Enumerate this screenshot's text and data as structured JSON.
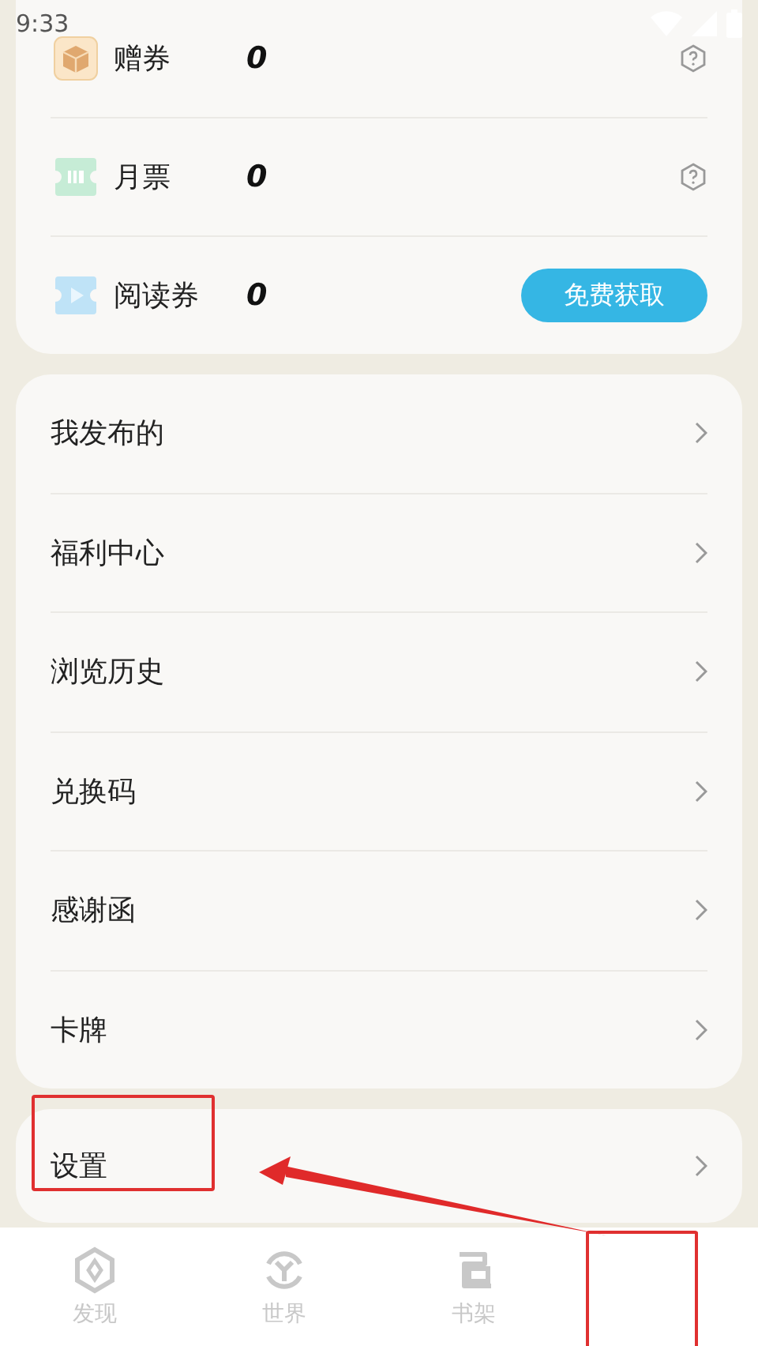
{
  "status_bar": {
    "time": "9:33"
  },
  "vouchers": [
    {
      "kind": "gift",
      "label": "赠券",
      "count": "0",
      "help": true
    },
    {
      "kind": "ticket",
      "label": "月票",
      "count": "0",
      "help": true
    },
    {
      "kind": "play",
      "label": "阅读券",
      "count": "0",
      "help": false,
      "button": "免费获取"
    }
  ],
  "menu": [
    {
      "label": "我发布的"
    },
    {
      "label": "福利中心"
    },
    {
      "label": "浏览历史"
    },
    {
      "label": "兑换码"
    },
    {
      "label": "感谢函"
    },
    {
      "label": "卡牌"
    }
  ],
  "settings": {
    "label": "设置"
  },
  "tabs": [
    {
      "kind": "discover",
      "label": "发现",
      "selected": false
    },
    {
      "kind": "world",
      "label": "世界",
      "selected": false
    },
    {
      "kind": "shelf",
      "label": "书架",
      "selected": false
    },
    {
      "kind": "blank"
    }
  ],
  "annotations": [
    {
      "kind": "settings_box"
    },
    {
      "kind": "tab_box"
    },
    {
      "kind": "arrow"
    }
  ]
}
